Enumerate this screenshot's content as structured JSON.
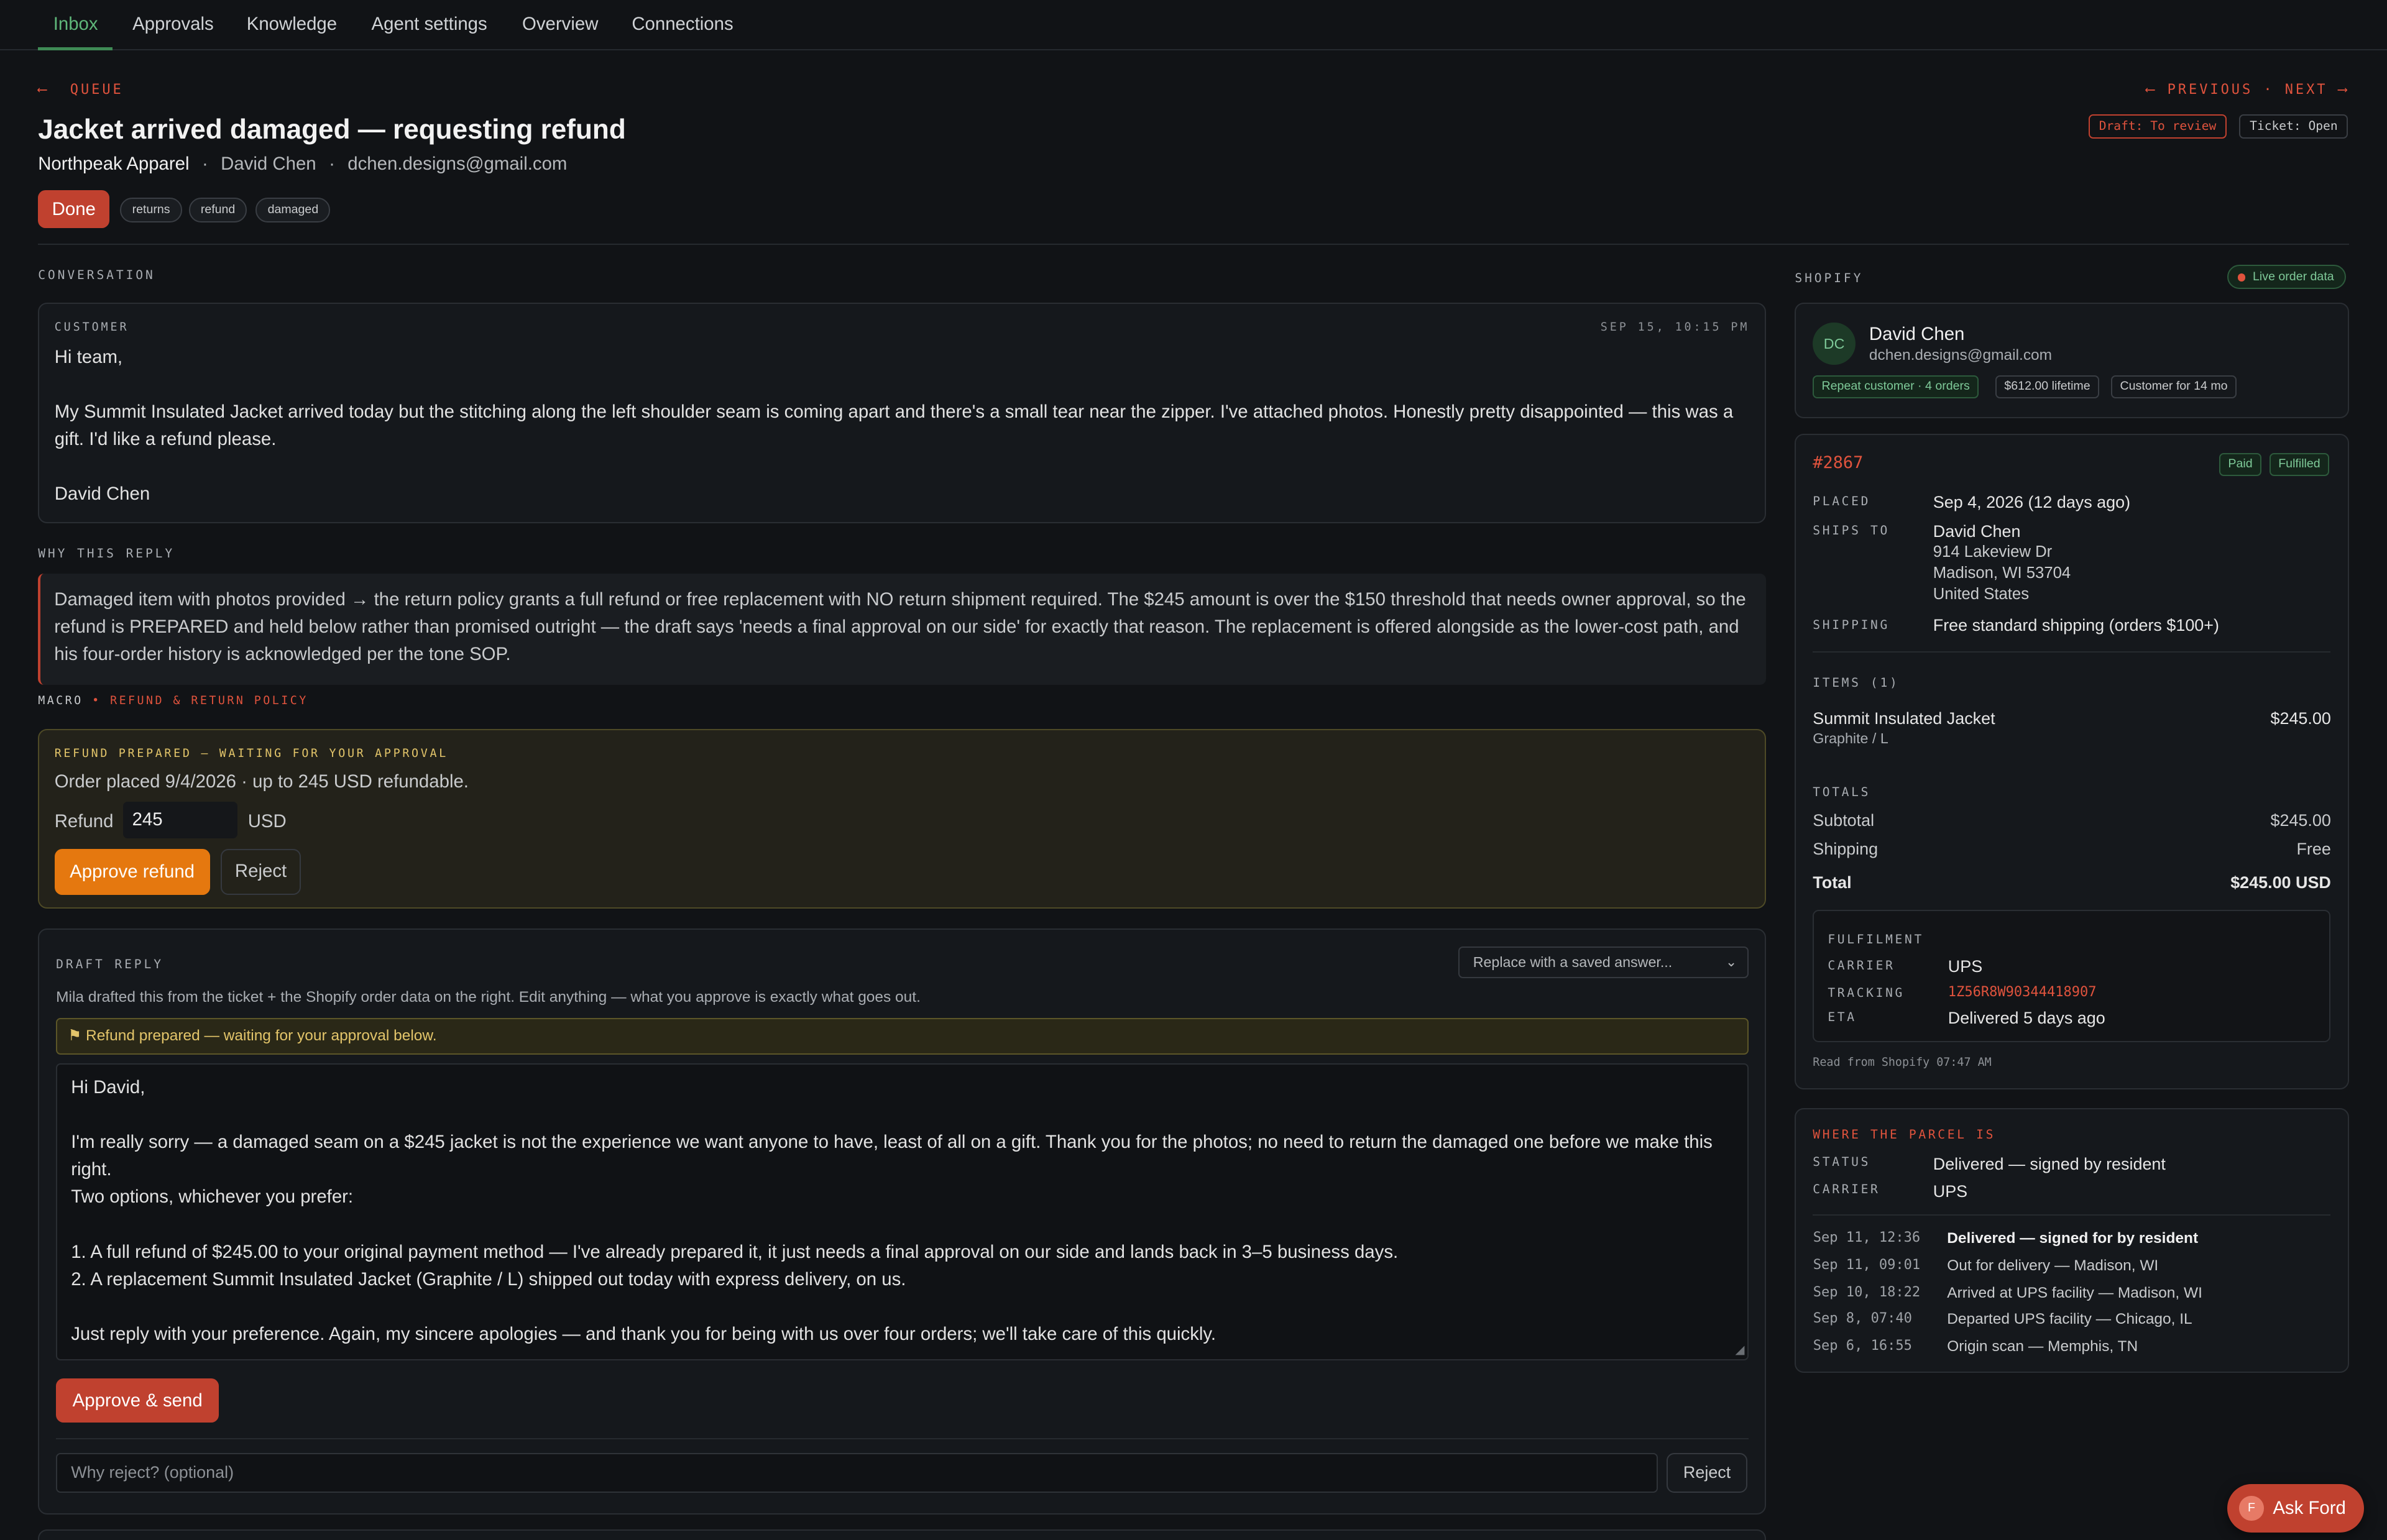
{
  "nav": {
    "tabs": [
      "Inbox",
      "Approvals",
      "Knowledge",
      "Agent settings",
      "Overview",
      "Connections"
    ]
  },
  "back": {
    "arrow": "⟵",
    "label": "QUEUE"
  },
  "pager": {
    "prev_arrow": "⟵",
    "prev": "PREVIOUS",
    "dot": "·",
    "next": "NEXT",
    "next_arrow": "⟶"
  },
  "header": {
    "title": "Jacket arrived damaged — requesting refund",
    "store": "Northpeak Apparel",
    "sep": "·",
    "customer": "David Chen",
    "email": "dchen.designs@gmail.com",
    "draft_status": "Draft: To review",
    "ticket_status": "Ticket: Open",
    "done_label": "Done",
    "tags": [
      "returns",
      "refund",
      "damaged"
    ]
  },
  "conversation": {
    "section_label": "CONVERSATION",
    "role": "CUSTOMER",
    "time": "SEP 15, 10:15 PM",
    "lines": [
      "Hi team,",
      "My Summit Insulated Jacket arrived today but the stitching along the left shoulder seam is coming apart and there's a small tear near the zipper. I've attached photos. Honestly pretty disappointed — this was a gift. I'd like a refund please.",
      "David Chen"
    ]
  },
  "why": {
    "label": "WHY THIS REPLY",
    "text": "Damaged item with photos provided → the return policy grants a full refund or free replacement with NO return shipment required. The $245 amount is over the $150 threshold that needs owner approval, so the refund is PREPARED and held below rather than promised outright — the draft says 'needs a final approval on our side' for exactly that reason. The replacement is offered alongside as the lower-cost path, and his four-order history is acknowledged per the tone SOP.",
    "macro_label": "MACRO",
    "macro_value": "• REFUND & RETURN POLICY"
  },
  "refund": {
    "heading": "REFUND PREPARED — WAITING FOR YOUR APPROVAL",
    "info": "Order placed 9/4/2026 · up to 245 USD refundable.",
    "field_label": "Refund",
    "amount": "245",
    "currency": "USD",
    "approve_label": "Approve refund",
    "reject_label": "Reject"
  },
  "draft": {
    "label": "DRAFT REPLY",
    "saved_answer_placeholder": "Replace with a saved answer...",
    "description": "Mila drafted this from the ticket + the Shopify order data on the right. Edit anything — what you approve is exactly what goes out.",
    "notice": "⚑ Refund prepared — waiting for your approval below.",
    "body_lines": [
      "Hi David,",
      "I'm really sorry — a damaged seam on a $245 jacket is not the experience we want anyone to have, least of all on a gift. Thank you for the photos; no need to return the damaged one before we make this right.",
      "Two options, whichever you prefer:",
      "1. A full refund of $245.00 to your original payment method — I've already prepared it, it just needs a final approval on our side and lands back in 3–5 business days.",
      "2. A replacement Summit Insulated Jacket (Graphite / L) shipped out today with express delivery, on us.",
      "Just reply with your preference. Again, my sincere apologies — and thank you for being with us over four orders; we'll take care of this quickly."
    ],
    "approve_send_label": "Approve & send",
    "reject_placeholder": "Why reject? (optional)",
    "reject_label": "Reject"
  },
  "shopify": {
    "label": "SHOPIFY",
    "live_label": "Live order data",
    "customer": {
      "initials": "DC",
      "name": "David Chen",
      "email": "dchen.designs@gmail.com",
      "badges": [
        "Repeat customer · 4 orders",
        "$612.00 lifetime",
        "Customer for 14 mo"
      ]
    },
    "order": {
      "number": "#2867",
      "badges": [
        "Paid",
        "Fulfilled"
      ],
      "placed_label": "PLACED",
      "placed": "Sep 4, 2026 (12 days ago)",
      "ships_to_label": "SHIPS TO",
      "address": [
        "David Chen",
        "914 Lakeview Dr",
        "Madison, WI 53704",
        "United States"
      ],
      "shipping_label": "SHIPPING",
      "shipping": "Free standard shipping (orders $100+)",
      "items_label": "ITEMS (1)",
      "item_name": "Summit Insulated Jacket",
      "item_variant": "Graphite / L",
      "item_price": "$245.00",
      "totals_label": "TOTALS",
      "subtotal_label": "Subtotal",
      "subtotal": "$245.00",
      "shipping_cost_label": "Shipping",
      "shipping_cost": "Free",
      "total_label": "Total",
      "total": "$245.00 USD",
      "fulfilment_label": "FULFILMENT",
      "carrier_label": "CARRIER",
      "carrier": "UPS",
      "tracking_label": "TRACKING",
      "tracking": "1Z56R8W90344418907",
      "eta_label": "ETA",
      "eta": "Delivered 5 days ago",
      "read_from": "Read from Shopify 07:47 AM"
    },
    "parcel": {
      "label": "WHERE THE PARCEL IS",
      "status_label": "STATUS",
      "status": "Delivered — signed by resident",
      "carrier_label": "CARRIER",
      "carrier": "UPS",
      "timeline": [
        {
          "time": "Sep 11, 12:36",
          "event": "Delivered — signed for by resident"
        },
        {
          "time": "Sep 11, 09:01",
          "event": "Out for delivery — Madison, WI"
        },
        {
          "time": "Sep 10, 18:22",
          "event": "Arrived at UPS facility — Madison, WI"
        },
        {
          "time": "Sep 8, 07:40",
          "event": "Departed UPS facility — Chicago, IL"
        },
        {
          "time": "Sep 6, 16:55",
          "event": "Origin scan — Memphis, TN"
        }
      ]
    }
  },
  "ask": {
    "initial": "F",
    "label": "Ask Ford"
  },
  "colors": {
    "accent_red": "#e0533d",
    "accent_green": "#5fb77a",
    "approve_orange": "#e5780f",
    "background": "#111316"
  }
}
